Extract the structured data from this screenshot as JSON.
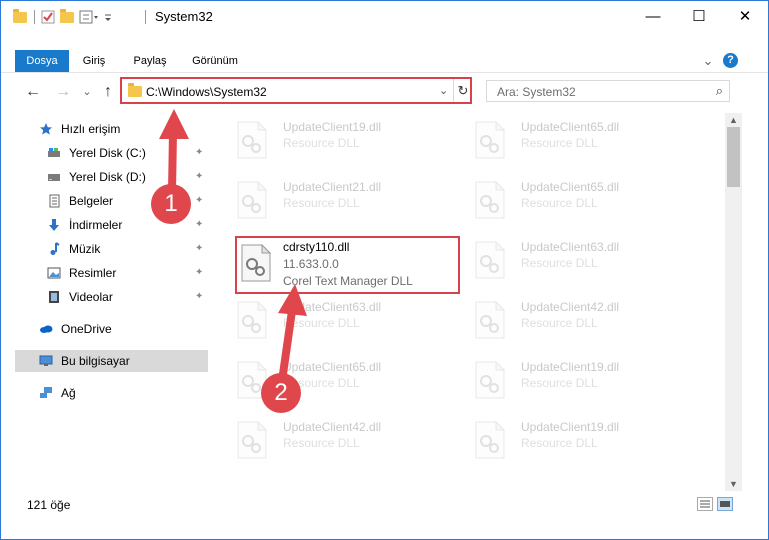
{
  "window": {
    "title": "System32",
    "minimize": "—",
    "maximize": "☐",
    "close": "✕"
  },
  "ribbon": {
    "tabs": [
      "Dosya",
      "Giriş",
      "Paylaş",
      "Görünüm"
    ],
    "collapse": "⌄",
    "help": "?"
  },
  "nav": {
    "back": "←",
    "forward": "→",
    "recent": "⌄",
    "up": "↑",
    "address": "C:\\Windows\\System32",
    "address_dropdown": "⌄",
    "refresh": "↻",
    "search_placeholder": "Ara: System32",
    "search_icon": "⌕"
  },
  "sidebar": {
    "items": [
      {
        "label": "Hızlı erişim",
        "icon": "star-icon",
        "pinned": false
      },
      {
        "label": "Yerel Disk (C:)",
        "icon": "drive-icon",
        "pinned": true
      },
      {
        "label": "Yerel Disk (D:)",
        "icon": "drive-icon",
        "pinned": true
      },
      {
        "label": "Belgeler",
        "icon": "documents-icon",
        "pinned": true
      },
      {
        "label": "İndirmeler",
        "icon": "download-icon",
        "pinned": true
      },
      {
        "label": "Müzik",
        "icon": "music-icon",
        "pinned": true
      },
      {
        "label": "Resimler",
        "icon": "pictures-icon",
        "pinned": true
      },
      {
        "label": "Videolar",
        "icon": "videos-icon",
        "pinned": true
      },
      {
        "label": "OneDrive",
        "icon": "cloud-icon",
        "pinned": false
      },
      {
        "label": "Bu bilgisayar",
        "icon": "computer-icon",
        "pinned": false,
        "selected": true
      },
      {
        "label": "Ağ",
        "icon": "network-icon",
        "pinned": false
      }
    ],
    "pin_glyph": "📌"
  },
  "files": {
    "selected": {
      "name": "cdrsty110.dll",
      "version": "11.633.0.0",
      "description": "Corel Text Manager DLL"
    },
    "left_column": [
      {
        "name": "UpdateClient19.dll",
        "description": "Resource DLL"
      },
      {
        "name": "UpdateClient21.dll",
        "description": "Resource DLL"
      },
      {
        "name": "UpdateClient63.dll",
        "description": "Resource DLL"
      },
      {
        "name": "UpdateClient65.dll",
        "description": "Resource DLL"
      },
      {
        "name": "UpdateClient42.dll",
        "description": "Resource DLL"
      }
    ],
    "right_column": [
      {
        "name": "UpdateClient65.dll",
        "description": "Resource DLL"
      },
      {
        "name": "UpdateClient65.dll",
        "description": "Resource DLL"
      },
      {
        "name": "UpdateClient63.dll",
        "description": "Resource DLL"
      },
      {
        "name": "UpdateClient42.dll",
        "description": "Resource DLL"
      },
      {
        "name": "UpdateClient19.dll",
        "description": "Resource DLL"
      },
      {
        "name": "UpdateClient19.dll",
        "description": "Resource DLL"
      }
    ]
  },
  "status": {
    "item_count": "121 öğe"
  },
  "annotations": {
    "step1": "1",
    "step2": "2"
  },
  "colors": {
    "accent": "#1979ca",
    "highlight": "#d8434b",
    "marker": "#e0474c"
  }
}
